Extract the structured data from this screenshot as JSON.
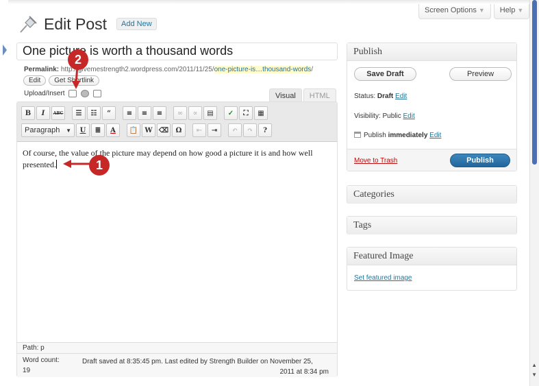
{
  "header": {
    "title": "Edit Post",
    "add_new": "Add New",
    "screen_options": "Screen Options",
    "help": "Help",
    "dropdown_arrow": "▼"
  },
  "post": {
    "title": "One picture is worth a thousand words",
    "permalink_label": "Permalink:",
    "permalink_base": "http://givemestrength2.wordpress.com/2011/11/25/",
    "permalink_slug": "one-picture-is…thousand-words",
    "permalink_tail": "/",
    "edit_label": "Edit",
    "shortlink_label": "Get Shortlink",
    "upload_insert": "Upload/Insert"
  },
  "editor": {
    "tabs": [
      "Visual",
      "HTML"
    ],
    "format_select": "Paragraph",
    "content": "Of course, the value of the picture may depend on how good a picture it is and how well presented.",
    "path": "Path: p",
    "word_count_label": "Word count:",
    "word_count": "19",
    "draft_saved_line1": "Draft saved at 8:35:45 pm. Last edited by Strength Builder on November 25,",
    "draft_saved_line2": "2011 at 8:34 pm"
  },
  "publish": {
    "heading": "Publish",
    "save_draft": "Save Draft",
    "preview": "Preview",
    "status_label": "Status: ",
    "status_value": "Draft",
    "visibility_label": "Visibility: Public",
    "publish_label": "Publish ",
    "publish_when": "immediately",
    "edit": "Edit",
    "trash": "Move to Trash",
    "publish_button": "Publish"
  },
  "sidebar": {
    "categories": "Categories",
    "tags": "Tags",
    "featured_image": "Featured Image",
    "set_featured": "Set featured image"
  },
  "callouts": {
    "one": "1",
    "two": "2"
  },
  "colors": {
    "callout": "#c62828",
    "link": "#21759b",
    "publish_button": "#21669c",
    "trash": "#bc0b0b"
  }
}
